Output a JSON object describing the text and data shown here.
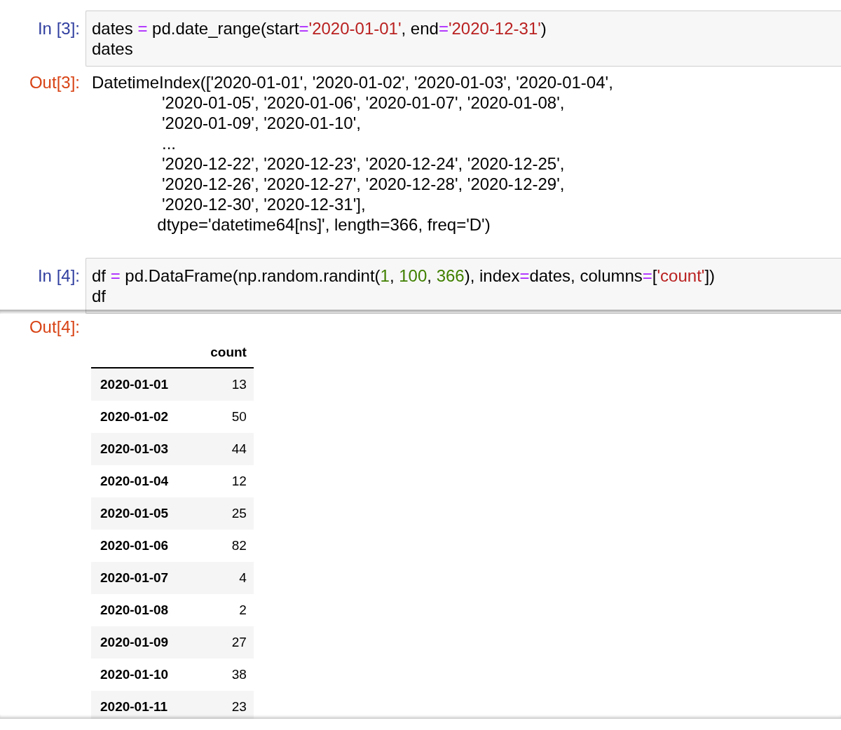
{
  "cells": [
    {
      "kind": "input",
      "prompt": "In [3]:",
      "lines": [
        [
          {
            "kind": "name",
            "text": "dates "
          },
          {
            "kind": "operator",
            "text": "="
          },
          {
            "kind": "name",
            "text": " pd.date_range(start"
          },
          {
            "kind": "operator",
            "text": "="
          },
          {
            "kind": "string",
            "text": "'2020-01-01'"
          },
          {
            "kind": "name",
            "text": ", end"
          },
          {
            "kind": "operator",
            "text": "="
          },
          {
            "kind": "string",
            "text": "'2020-12-31'"
          },
          {
            "kind": "name",
            "text": ")"
          }
        ],
        [
          {
            "kind": "name",
            "text": "dates"
          }
        ]
      ]
    },
    {
      "kind": "text_output",
      "prompt": "Out[3]:",
      "lines": [
        "DatetimeIndex(['2020-01-01', '2020-01-02', '2020-01-03', '2020-01-04',",
        "               '2020-01-05', '2020-01-06', '2020-01-07', '2020-01-08',",
        "               '2020-01-09', '2020-01-10',",
        "               ...",
        "               '2020-12-22', '2020-12-23', '2020-12-24', '2020-12-25',",
        "               '2020-12-26', '2020-12-27', '2020-12-28', '2020-12-29',",
        "               '2020-12-30', '2020-12-31'],",
        "              dtype='datetime64[ns]', length=366, freq='D')"
      ]
    },
    {
      "kind": "input",
      "prompt": "In [4]:",
      "lines": [
        [
          {
            "kind": "name",
            "text": "df "
          },
          {
            "kind": "operator",
            "text": "="
          },
          {
            "kind": "name",
            "text": " pd.DataFrame(np.random.randint("
          },
          {
            "kind": "number",
            "text": "1"
          },
          {
            "kind": "name",
            "text": ", "
          },
          {
            "kind": "number",
            "text": "100"
          },
          {
            "kind": "name",
            "text": ", "
          },
          {
            "kind": "number",
            "text": "366"
          },
          {
            "kind": "name",
            "text": "), index"
          },
          {
            "kind": "operator",
            "text": "="
          },
          {
            "kind": "name",
            "text": "dates, columns"
          },
          {
            "kind": "operator",
            "text": "="
          },
          {
            "kind": "name",
            "text": "["
          },
          {
            "kind": "string",
            "text": "'count'"
          },
          {
            "kind": "name",
            "text": "])"
          }
        ],
        [
          {
            "kind": "name",
            "text": "df"
          }
        ]
      ]
    },
    {
      "kind": "table_output",
      "prompt": "Out[4]:",
      "columns": [
        "count"
      ],
      "rows": [
        {
          "index": "2020-01-01",
          "values": [
            "13"
          ]
        },
        {
          "index": "2020-01-02",
          "values": [
            "50"
          ]
        },
        {
          "index": "2020-01-03",
          "values": [
            "44"
          ]
        },
        {
          "index": "2020-01-04",
          "values": [
            "12"
          ]
        },
        {
          "index": "2020-01-05",
          "values": [
            "25"
          ]
        },
        {
          "index": "2020-01-06",
          "values": [
            "82"
          ]
        },
        {
          "index": "2020-01-07",
          "values": [
            "4"
          ]
        },
        {
          "index": "2020-01-08",
          "values": [
            "2"
          ]
        },
        {
          "index": "2020-01-09",
          "values": [
            "27"
          ]
        },
        {
          "index": "2020-01-10",
          "values": [
            "38"
          ]
        },
        {
          "index": "2020-01-11",
          "values": [
            "23"
          ]
        }
      ]
    }
  ]
}
